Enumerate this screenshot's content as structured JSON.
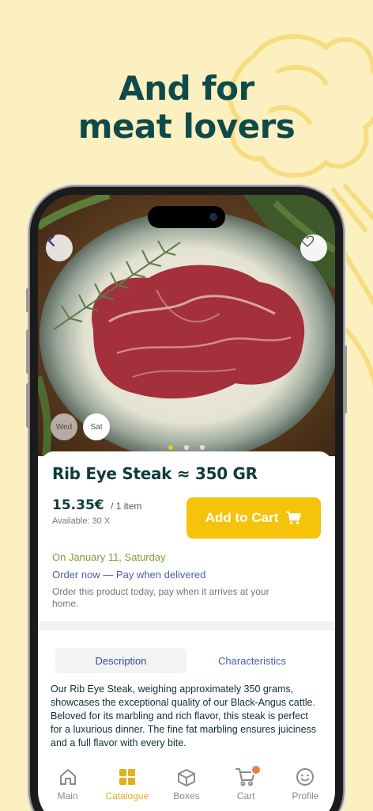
{
  "headline": {
    "line1": "And for",
    "line2": "meat lovers"
  },
  "photo": {
    "days": [
      "Wed",
      "Sat"
    ],
    "carousel_active_index": 0,
    "carousel_count": 3
  },
  "product": {
    "title": "Rib Eye Steak ≈ 350 GR",
    "price": "15.35€",
    "per_item": "/ 1 item",
    "available": "Available: 30 X",
    "add_to_cart": "Add to Cart",
    "delivery_date": "On January 11, Saturday",
    "order_now": "Order now — Pay when delivered",
    "order_desc": "Order this product today, pay when it arrives at your home."
  },
  "tabs": {
    "description": "Description",
    "characteristics": "Characteristics"
  },
  "description_text": "Our Rib Eye Steak, weighing approximately 350 grams, showcases the exceptional quality of our Black-Angus cattle. Beloved for its marbling and rich flavor, this steak is perfect for a luxurious dinner. The fine fat marbling ensures juiciness and a full flavor with every bite.",
  "nav": {
    "main": "Main",
    "catalogue": "Catalogue",
    "boxes": "Boxes",
    "cart": "Cart",
    "profile": "Profile"
  },
  "colors": {
    "background": "#fdf0c0",
    "headline": "#0f4a4a",
    "accent": "#f5c40a",
    "delivery_green": "#7b9e3a",
    "link_blue": "#4a5fa8"
  }
}
